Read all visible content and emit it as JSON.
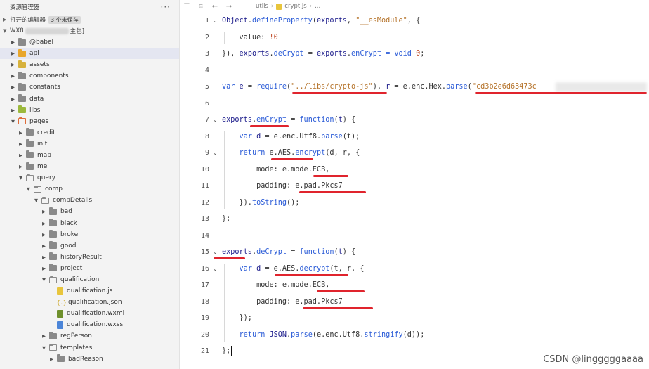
{
  "explorer": {
    "title": "资源管理器",
    "more": "···",
    "open_editors_label": "打开的编辑器",
    "unsaved_label": "3 个未保存",
    "project_prefix": "WX8",
    "project_suffix": "主包]",
    "items": [
      {
        "label": "@babel",
        "indent": 0,
        "kind": "folder",
        "color": "gray",
        "state": "closed"
      },
      {
        "label": "api",
        "indent": 0,
        "kind": "folder",
        "color": "api",
        "state": "closed",
        "selected": true
      },
      {
        "label": "assets",
        "indent": 0,
        "kind": "folder",
        "color": "assets",
        "state": "closed"
      },
      {
        "label": "components",
        "indent": 0,
        "kind": "folder",
        "color": "gray",
        "state": "closed"
      },
      {
        "label": "constants",
        "indent": 0,
        "kind": "folder",
        "color": "gray",
        "state": "closed"
      },
      {
        "label": "data",
        "indent": 0,
        "kind": "folder",
        "color": "gray",
        "state": "closed"
      },
      {
        "label": "libs",
        "indent": 0,
        "kind": "folder",
        "color": "libs",
        "state": "closed"
      },
      {
        "label": "pages",
        "indent": 0,
        "kind": "folder",
        "color": "pages",
        "state": "open"
      },
      {
        "label": "credit",
        "indent": 1,
        "kind": "folder",
        "color": "gray",
        "state": "closed"
      },
      {
        "label": "init",
        "indent": 1,
        "kind": "folder",
        "color": "gray",
        "state": "closed"
      },
      {
        "label": "map",
        "indent": 1,
        "kind": "folder",
        "color": "gray",
        "state": "closed"
      },
      {
        "label": "me",
        "indent": 1,
        "kind": "folder",
        "color": "gray",
        "state": "closed"
      },
      {
        "label": "query",
        "indent": 1,
        "kind": "folder",
        "color": "gray",
        "state": "open"
      },
      {
        "label": "comp",
        "indent": 2,
        "kind": "folder",
        "color": "gray",
        "state": "open"
      },
      {
        "label": "compDetails",
        "indent": 3,
        "kind": "folder",
        "color": "gray",
        "state": "open"
      },
      {
        "label": "bad",
        "indent": 4,
        "kind": "folder",
        "color": "gray",
        "state": "closed"
      },
      {
        "label": "black",
        "indent": 4,
        "kind": "folder",
        "color": "gray",
        "state": "closed"
      },
      {
        "label": "broke",
        "indent": 4,
        "kind": "folder",
        "color": "gray",
        "state": "closed"
      },
      {
        "label": "good",
        "indent": 4,
        "kind": "folder",
        "color": "gray",
        "state": "closed"
      },
      {
        "label": "historyResult",
        "indent": 4,
        "kind": "folder",
        "color": "gray",
        "state": "closed"
      },
      {
        "label": "project",
        "indent": 4,
        "kind": "folder",
        "color": "gray",
        "state": "closed"
      },
      {
        "label": "qualification",
        "indent": 4,
        "kind": "folder",
        "color": "gray",
        "state": "open"
      },
      {
        "label": "qualification.js",
        "indent": 5,
        "kind": "js"
      },
      {
        "label": "qualification.json",
        "indent": 5,
        "kind": "json"
      },
      {
        "label": "qualification.wxml",
        "indent": 5,
        "kind": "wxml"
      },
      {
        "label": "qualification.wxss",
        "indent": 5,
        "kind": "wxss"
      },
      {
        "label": "regPerson",
        "indent": 4,
        "kind": "folder",
        "color": "gray",
        "state": "closed"
      },
      {
        "label": "templates",
        "indent": 4,
        "kind": "folder",
        "color": "gray",
        "state": "open"
      },
      {
        "label": "badReason",
        "indent": 5,
        "kind": "folder",
        "color": "gray",
        "state": "closed"
      }
    ]
  },
  "editor": {
    "toolbar_icons": [
      "list-icon",
      "bookmark-icon",
      "back-arrow-icon",
      "forward-arrow-icon"
    ],
    "breadcrumb": [
      "utils",
      "crypt.js",
      "..."
    ],
    "lines": [
      {
        "n": "1",
        "tokens": [
          [
            "obj",
            "Object"
          ],
          [
            "",
            "."
          ],
          [
            "fn",
            "defineProperty"
          ],
          [
            "",
            "("
          ],
          [
            "obj",
            "exports"
          ],
          [
            "",
            ", "
          ],
          [
            "str",
            "\"__esModule\""
          ],
          [
            "",
            ", {"
          ]
        ],
        "fold": true
      },
      {
        "n": "2",
        "tokens": [
          [
            "",
            "    value: "
          ],
          [
            "num",
            "!0"
          ]
        ]
      },
      {
        "n": "3",
        "tokens": [
          [
            "",
            "}), "
          ],
          [
            "obj",
            "exports"
          ],
          [
            "",
            "."
          ],
          [
            "fn",
            "deCrypt"
          ],
          [
            "",
            " = "
          ],
          [
            "obj",
            "exports"
          ],
          [
            "",
            "."
          ],
          [
            "fn",
            "enCrypt"
          ],
          [
            "kw",
            " = void "
          ],
          [
            "num",
            "0"
          ],
          [
            "",
            ";"
          ]
        ]
      },
      {
        "n": "4",
        "tokens": []
      },
      {
        "n": "5",
        "tokens": [
          [
            "kw",
            "var "
          ],
          [
            "obj",
            "e"
          ],
          [
            "",
            " = "
          ],
          [
            "fn",
            "require"
          ],
          [
            "",
            "("
          ],
          [
            "str",
            "\"../libs/crypto-js\""
          ],
          [
            "",
            "), "
          ],
          [
            "obj",
            "r"
          ],
          [
            "",
            " = e.enc.Hex."
          ],
          [
            "fn",
            "parse"
          ],
          [
            "",
            "("
          ],
          [
            "str",
            "\"cd3b2e6d63473c"
          ]
        ]
      },
      {
        "n": "6",
        "tokens": []
      },
      {
        "n": "7",
        "tokens": [
          [
            "obj",
            "exports"
          ],
          [
            "",
            "."
          ],
          [
            "fn",
            "enCrypt"
          ],
          [
            "",
            " = "
          ],
          [
            "kw",
            "function"
          ],
          [
            "",
            "("
          ],
          [
            "obj",
            "t"
          ],
          [
            "",
            ") {"
          ]
        ],
        "fold": true
      },
      {
        "n": "8",
        "tokens": [
          [
            "",
            "    "
          ],
          [
            "kw",
            "var "
          ],
          [
            "obj",
            "d"
          ],
          [
            "",
            " = e.enc.Utf8."
          ],
          [
            "fn",
            "parse"
          ],
          [
            "",
            "(t);"
          ]
        ]
      },
      {
        "n": "9",
        "tokens": [
          [
            "",
            "    "
          ],
          [
            "kw",
            "return "
          ],
          [
            "",
            "e.AES."
          ],
          [
            "fn",
            "encrypt"
          ],
          [
            "",
            "(d, r, {"
          ]
        ],
        "fold": true
      },
      {
        "n": "10",
        "tokens": [
          [
            "",
            "        mode: e.mode.ECB,"
          ]
        ]
      },
      {
        "n": "11",
        "tokens": [
          [
            "",
            "        padding: e.pad.Pkcs7"
          ]
        ]
      },
      {
        "n": "12",
        "tokens": [
          [
            "",
            "    })."
          ],
          [
            "fn",
            "toString"
          ],
          [
            "",
            "();"
          ]
        ]
      },
      {
        "n": "13",
        "tokens": [
          [
            "",
            "};"
          ]
        ]
      },
      {
        "n": "14",
        "tokens": []
      },
      {
        "n": "15",
        "tokens": [
          [
            "obj",
            "exports"
          ],
          [
            "",
            "."
          ],
          [
            "fn",
            "deCrypt"
          ],
          [
            "",
            " = "
          ],
          [
            "kw",
            "function"
          ],
          [
            "",
            "("
          ],
          [
            "obj",
            "t"
          ],
          [
            "",
            ") {"
          ]
        ],
        "fold": true
      },
      {
        "n": "16",
        "tokens": [
          [
            "",
            "    "
          ],
          [
            "kw",
            "var "
          ],
          [
            "obj",
            "d"
          ],
          [
            "",
            " = e.AES."
          ],
          [
            "fn",
            "decrypt"
          ],
          [
            "",
            "(t, r, {"
          ]
        ],
        "fold": true
      },
      {
        "n": "17",
        "tokens": [
          [
            "",
            "        mode: e.mode.ECB,"
          ]
        ]
      },
      {
        "n": "18",
        "tokens": [
          [
            "",
            "        padding: e.pad.Pkcs7"
          ]
        ]
      },
      {
        "n": "19",
        "tokens": [
          [
            "",
            "    });"
          ]
        ]
      },
      {
        "n": "20",
        "tokens": [
          [
            "",
            "    "
          ],
          [
            "kw",
            "return "
          ],
          [
            "obj",
            "JSON"
          ],
          [
            "",
            "."
          ],
          [
            "fn",
            "parse"
          ],
          [
            "",
            "(e.enc.Utf8."
          ],
          [
            "fn",
            "stringify"
          ],
          [
            "",
            "(d));"
          ]
        ]
      },
      {
        "n": "21",
        "tokens": [
          [
            "",
            "};"
          ]
        ]
      }
    ]
  },
  "watermark": "CSDN @lingggggaaaa",
  "colors": {
    "annotation_red": "#e0242d",
    "keyword_blue": "#2a5bd7",
    "string_orange": "#b5732a",
    "selected_row": "#e4e6f1"
  }
}
